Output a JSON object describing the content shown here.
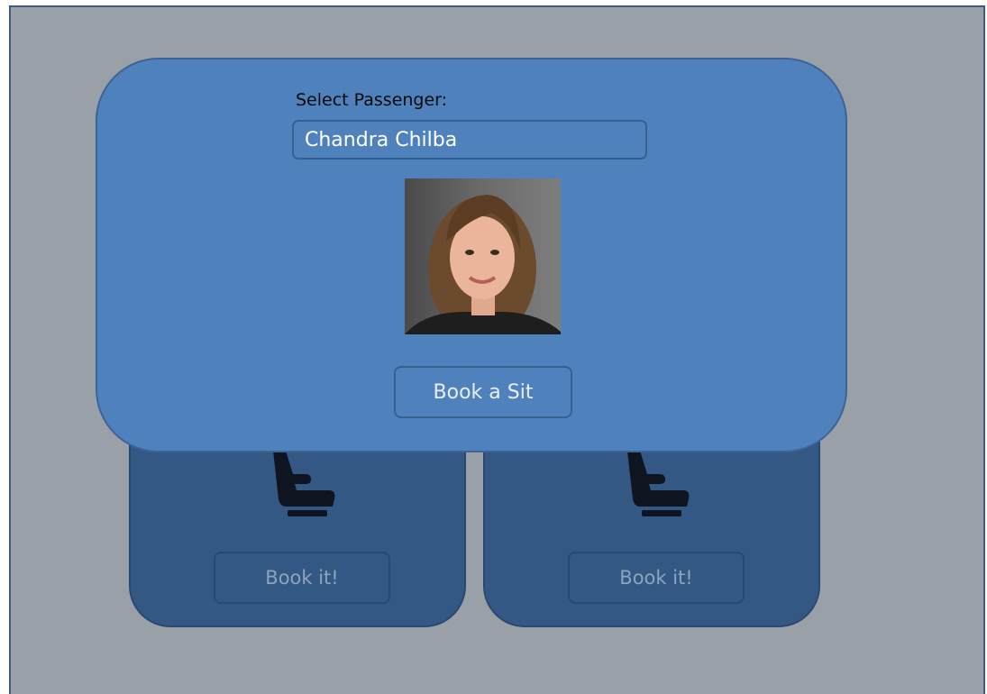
{
  "passenger_picker": {
    "label": "Select Passenger:",
    "selected_passenger": "Chandra Chilba",
    "book_button_label": "Book a Sit"
  },
  "seats": [
    {
      "icon": "seat-icon",
      "button_label": "Book it!"
    },
    {
      "icon": "seat-icon",
      "button_label": "Book it!"
    }
  ],
  "colors": {
    "background": "#9aa0a8",
    "modal": "#4f81bd",
    "seat_card": "#335884"
  }
}
